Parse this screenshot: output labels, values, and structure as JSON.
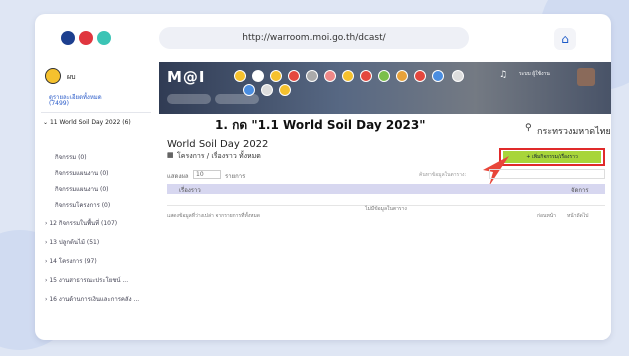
{
  "browser": {
    "url": "http://warroom.moi.go.th/dcast/",
    "dots": [
      "#1d3f8f",
      "#e0363f",
      "#3bc4b5"
    ]
  },
  "sidebar": {
    "user": "ผบ",
    "log_link": "ดูรายละเอียดทั้งหมด",
    "log_count": "(7499)",
    "active_item": "11 World Soil Day 2022",
    "active_count": "(6)",
    "sub_items": [
      "กิจกรรม (0)",
      "กิจกรรมแผนงาน (0)",
      "กิจกรรมแผนงาน (0)",
      "กิจกรรมโครงการ (0)"
    ],
    "items": [
      "12 กิจกรรมในพื้นที่ (107)",
      "13 ปลูกต้นไม้ (51)",
      "14 โครงการ (97)",
      "15 งานสาธารณะประโยชน์ ...",
      "16 งานด้านการเงินและการคลัง ..."
    ]
  },
  "topnav": {
    "logo": "M@I",
    "bell_icon": "bell-icon",
    "account": "ระบบ ผู้ใช้งาน"
  },
  "annotation": "1. กด \"1.1 World Soil Day 2023\"",
  "ministry": "กระทรวงมหาดไทย",
  "page": {
    "title": "World Soil Day 2022",
    "breadcrumb": "โครงการ / เรื่องราว ทั้งหมด",
    "add_button": "+ เพิ่มกิจกรรม/เรื่องราว",
    "show_label": "แสดงผล",
    "rows_value": "10",
    "rows_suffix": "รายการ",
    "search_label": "ค้นหาข้อมูลในตาราง:",
    "table_headers": [
      "เรื่องราว",
      "จัดการ"
    ],
    "empty_message": "ไม่มีข้อมูลในตาราง",
    "footer_info": "แสดงข้อมูลที่ว่างเปล่า จากรายการที่ทั้งหมด",
    "pager_prev": "ก่อนหน้า",
    "pager_next": "หน้าถัดไป"
  },
  "colors": {
    "accent_green": "#a8d53a",
    "highlight_red": "#e02a2a",
    "arrow_red": "#e8463a",
    "nav_dark": "#3b4a66"
  }
}
